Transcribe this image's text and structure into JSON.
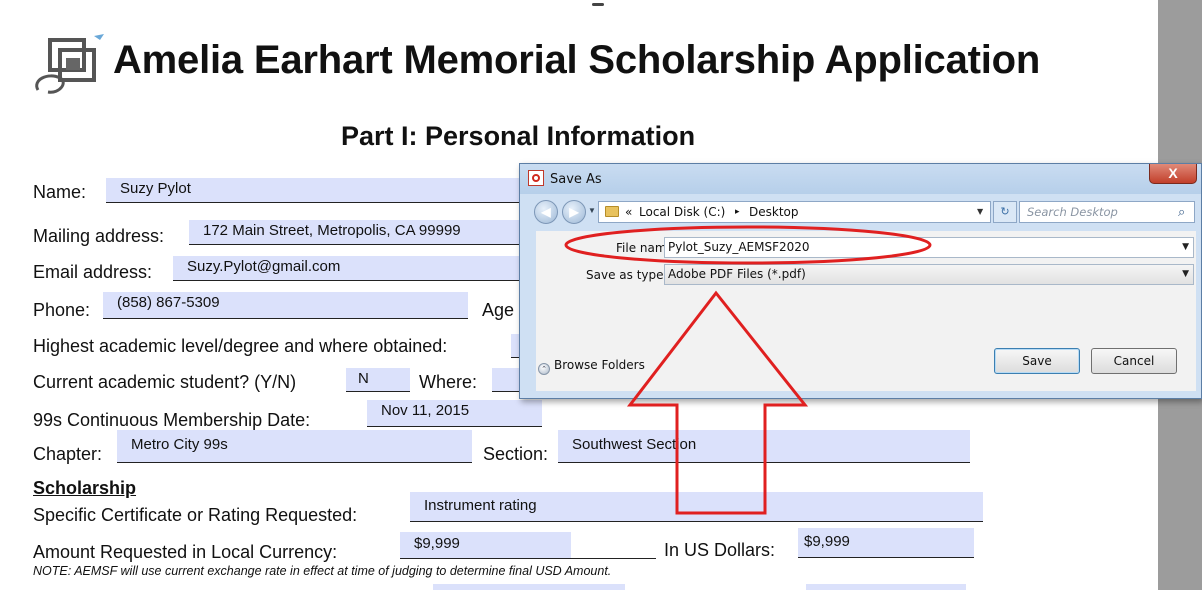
{
  "document": {
    "title": "Amelia Earhart Memorial Scholarship Application",
    "part_title": "Part I: Personal Information",
    "labels": {
      "name": "Name:",
      "mailing": "Mailing address:",
      "email": "Email address:",
      "phone": "Phone:",
      "age": "Age",
      "academic": "Highest academic level/degree and where obtained:",
      "student": "Current academic student? (Y/N)",
      "where": "Where:",
      "membership": "99s Continuous Membership Date:",
      "chapter": "Chapter:",
      "section": "Section:",
      "scholarship_head": "Scholarship",
      "certificate": "Specific Certificate or Rating Requested:",
      "amount_local": "Amount Requested in Local Currency:",
      "amount_usd": "In US Dollars:"
    },
    "values": {
      "name": "Suzy Pylot",
      "mailing": "172 Main Street, Metropolis, CA 99999",
      "email": "Suzy.Pylot@gmail.com",
      "phone": "(858) 867-5309",
      "student": "N",
      "membership": "Nov 11, 2015",
      "chapter": "Metro City 99s",
      "section": "Southwest Section",
      "certificate": "Instrument rating",
      "amount_local": "$9,999",
      "amount_usd": "$9,999"
    },
    "note": "NOTE: AEMSF will use current exchange rate in effect at time of judging to determine final USD Amount."
  },
  "dialog": {
    "title": "Save As",
    "close_label": "X",
    "path": {
      "prefix": "«",
      "parts": [
        "Local Disk (C:)",
        "Desktop"
      ],
      "separator": "▸"
    },
    "search_placeholder": "Search Desktop",
    "file_name_label": "File name:",
    "file_name_value": "Pylot_Suzy_AEMSF2020",
    "save_type_label": "Save as type:",
    "save_type_value": "Adobe PDF Files (*.pdf)",
    "browse_folders": "Browse Folders",
    "save_button": "Save",
    "cancel_button": "Cancel"
  },
  "annotation_color": "#e02020",
  "field_fill": "#dbe1fb"
}
